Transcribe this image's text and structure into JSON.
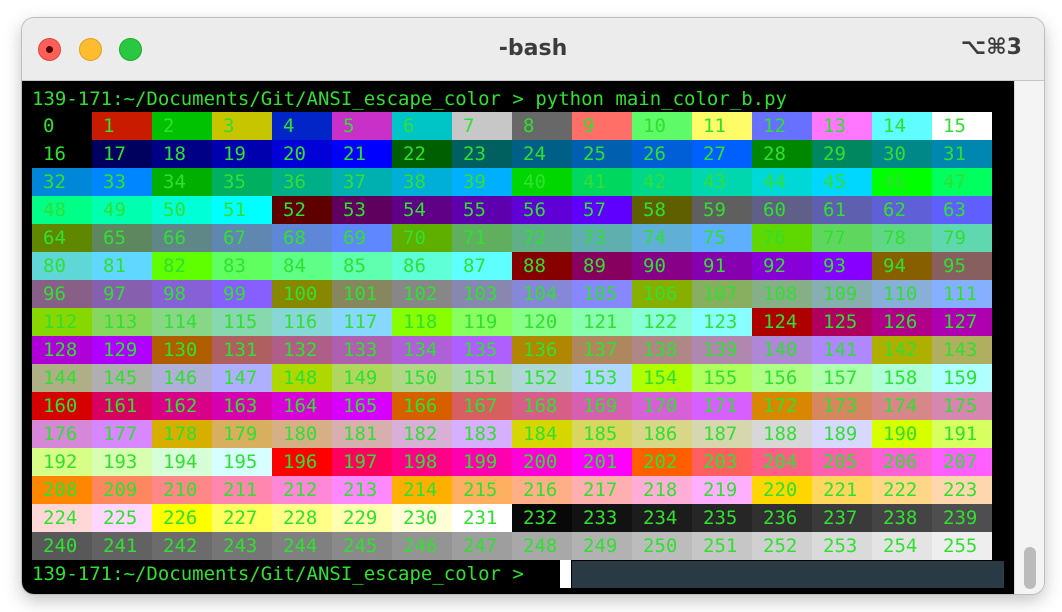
{
  "window": {
    "title": "-bash",
    "shortcut": "⌥⌘3"
  },
  "terminal": {
    "prompt": "139-171:~/Documents/Git/ANSI_escape_color > ",
    "command": "python main_color_b.py",
    "last_prompt": "139-171:~/Documents/Git/ANSI_escape_color > ",
    "text_color": "#30e030"
  },
  "colors": [
    "#000000",
    "#c91b00",
    "#00c200",
    "#c7c400",
    "#0225c7",
    "#c930c7",
    "#00c5c7",
    "#c7c7c7",
    "#686868",
    "#ff6e67",
    "#5ffa68",
    "#fffc67",
    "#6871ff",
    "#ff76ff",
    "#5ffdff",
    "#ffffff",
    "#000000",
    "#00005f",
    "#000087",
    "#0000af",
    "#0000d7",
    "#0000ff",
    "#005f00",
    "#005f5f",
    "#005f87",
    "#005faf",
    "#005fd7",
    "#005fff",
    "#008700",
    "#00875f",
    "#008787",
    "#0087af",
    "#0087d7",
    "#0087ff",
    "#00af00",
    "#00af5f",
    "#00af87",
    "#00afaf",
    "#00afd7",
    "#00afff",
    "#00d700",
    "#00d75f",
    "#00d787",
    "#00d7af",
    "#00d7d7",
    "#00d7ff",
    "#00ff00",
    "#00ff5f",
    "#00ff87",
    "#00ffaf",
    "#00ffd7",
    "#00ffff",
    "#5f0000",
    "#5f005f",
    "#5f0087",
    "#5f00af",
    "#5f00d7",
    "#5f00ff",
    "#5f5f00",
    "#5f5f5f",
    "#5f5f87",
    "#5f5faf",
    "#5f5fd7",
    "#5f5fff",
    "#5f8700",
    "#5f875f",
    "#5f8787",
    "#5f87af",
    "#5f87d7",
    "#5f87ff",
    "#5faf00",
    "#5faf5f",
    "#5faf87",
    "#5fafaf",
    "#5fafd7",
    "#5fafff",
    "#5fd700",
    "#5fd75f",
    "#5fd787",
    "#5fd7af",
    "#5fd7d7",
    "#5fd7ff",
    "#5fff00",
    "#5fff5f",
    "#5fff87",
    "#5fffaf",
    "#5fffd7",
    "#5fffff",
    "#870000",
    "#87005f",
    "#870087",
    "#8700af",
    "#8700d7",
    "#8700ff",
    "#875f00",
    "#875f5f",
    "#875f87",
    "#875faf",
    "#875fd7",
    "#875fff",
    "#878700",
    "#87875f",
    "#878787",
    "#8787af",
    "#8787d7",
    "#8787ff",
    "#87af00",
    "#87af5f",
    "#87af87",
    "#87afaf",
    "#87afd7",
    "#87afff",
    "#87d700",
    "#87d75f",
    "#87d787",
    "#87d7af",
    "#87d7d7",
    "#87d7ff",
    "#87ff00",
    "#87ff5f",
    "#87ff87",
    "#87ffaf",
    "#87ffd7",
    "#87ffff",
    "#af0000",
    "#af005f",
    "#af0087",
    "#af00af",
    "#af00d7",
    "#af00ff",
    "#af5f00",
    "#af5f5f",
    "#af5f87",
    "#af5faf",
    "#af5fd7",
    "#af5fff",
    "#af8700",
    "#af875f",
    "#af8787",
    "#af87af",
    "#af87d7",
    "#af87ff",
    "#afaf00",
    "#afaf5f",
    "#afaf87",
    "#afafaf",
    "#afafd7",
    "#afafff",
    "#afd700",
    "#afd75f",
    "#afd787",
    "#afd7af",
    "#afd7d7",
    "#afd7ff",
    "#afff00",
    "#afff5f",
    "#afff87",
    "#afffaf",
    "#afffd7",
    "#afffff",
    "#d70000",
    "#d7005f",
    "#d70087",
    "#d700af",
    "#d700d7",
    "#d700ff",
    "#d75f00",
    "#d75f5f",
    "#d75f87",
    "#d75faf",
    "#d75fd7",
    "#d75fff",
    "#d78700",
    "#d7875f",
    "#d78787",
    "#d787af",
    "#d787d7",
    "#d787ff",
    "#d7af00",
    "#d7af5f",
    "#d7af87",
    "#d7afaf",
    "#d7afd7",
    "#d7afff",
    "#d7d700",
    "#d7d75f",
    "#d7d787",
    "#d7d7af",
    "#d7d7d7",
    "#d7d7ff",
    "#d7ff00",
    "#d7ff5f",
    "#d7ff87",
    "#d7ffaf",
    "#d7ffd7",
    "#d7ffff",
    "#ff0000",
    "#ff005f",
    "#ff0087",
    "#ff00af",
    "#ff00d7",
    "#ff00ff",
    "#ff5f00",
    "#ff5f5f",
    "#ff5f87",
    "#ff5faf",
    "#ff5fd7",
    "#ff5fff",
    "#ff8700",
    "#ff875f",
    "#ff8787",
    "#ff87af",
    "#ff87d7",
    "#ff87ff",
    "#ffaf00",
    "#ffaf5f",
    "#ffaf87",
    "#ffafaf",
    "#ffafd7",
    "#ffafff",
    "#ffd700",
    "#ffd75f",
    "#ffd787",
    "#ffd7af",
    "#ffd7d7",
    "#ffd7ff",
    "#ffff00",
    "#ffff5f",
    "#ffff87",
    "#ffffaf",
    "#ffffd7",
    "#ffffff",
    "#080808",
    "#121212",
    "#1c1c1c",
    "#262626",
    "#303030",
    "#3a3a3a",
    "#444444",
    "#4e4e4e",
    "#585858",
    "#626262",
    "#6c6c6c",
    "#767676",
    "#808080",
    "#8a8a8a",
    "#949494",
    "#9e9e9e",
    "#a8a8a8",
    "#b2b2b2",
    "#bcbcbc",
    "#c6c6c6",
    "#d0d0d0",
    "#dadada",
    "#e4e4e4",
    "#eeeeee"
  ]
}
